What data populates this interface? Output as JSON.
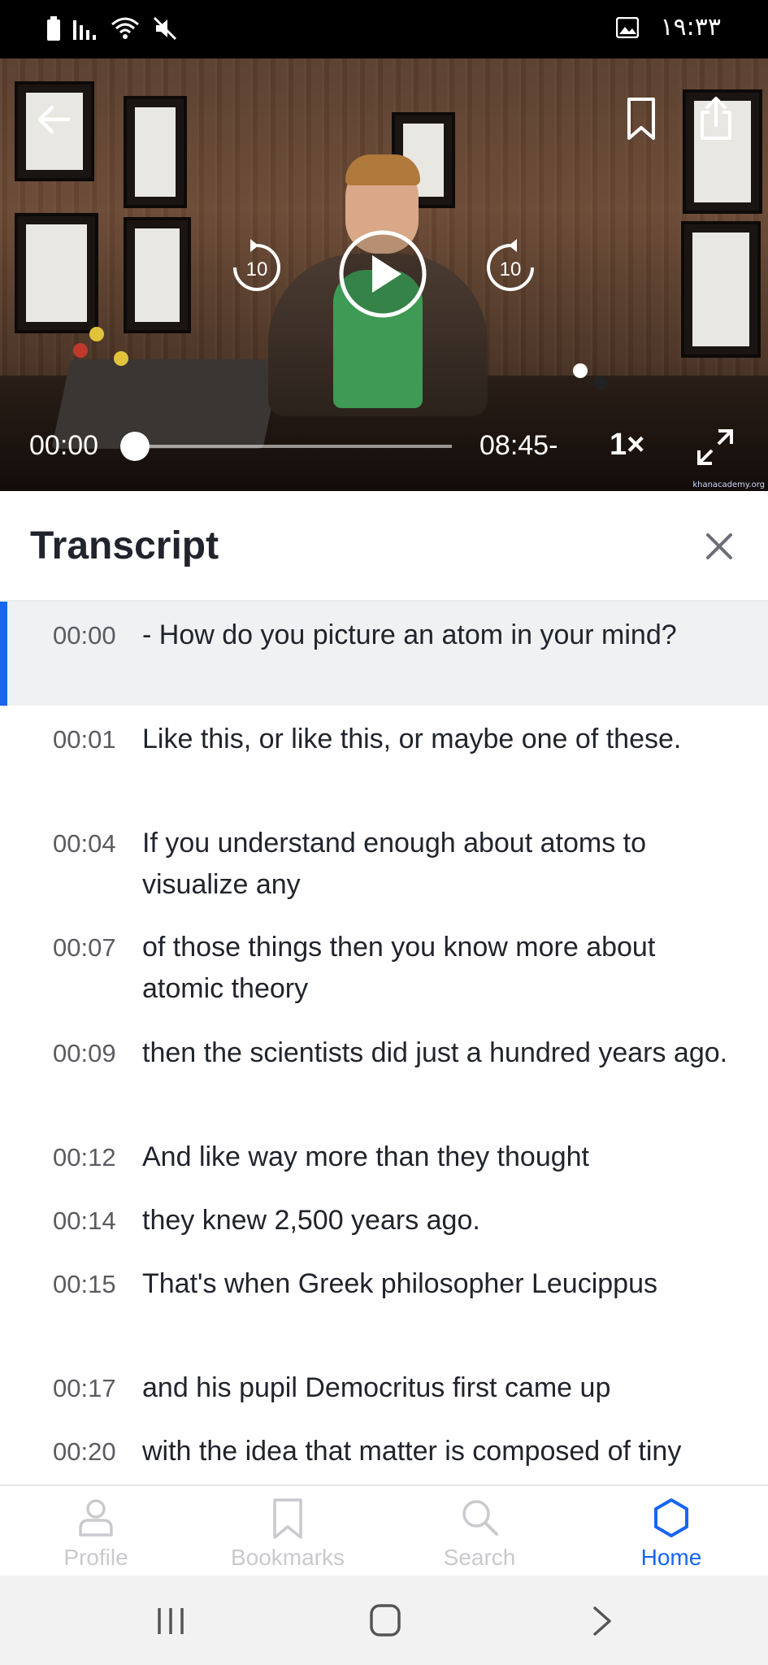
{
  "status_bar": {
    "time": "۱۹:۳۳",
    "icons": [
      "battery-icon",
      "signal-icon",
      "wifi-icon",
      "mute-icon",
      "image-icon"
    ]
  },
  "video": {
    "current_time": "00:00",
    "remaining_time": "08:45-",
    "speed": "1×",
    "rewind_seconds": "10",
    "forward_seconds": "10",
    "progress": 0,
    "watermark": "khanacademy.org"
  },
  "transcript": {
    "title": "Transcript",
    "lines": [
      {
        "time": "00:00",
        "text": "- How do you picture an atom in your mind?",
        "active": true
      },
      {
        "time": "00:01",
        "text": "Like this, or like this, or maybe one of these.",
        "active": false
      },
      {
        "time": "00:04",
        "text": "If you understand enough about atoms to visualize any",
        "active": false
      },
      {
        "time": "00:07",
        "text": "of those things then you know more about atomic theory",
        "active": false
      },
      {
        "time": "00:09",
        "text": "then the scientists did just a hundred years ago.",
        "active": false
      },
      {
        "time": "00:12",
        "text": "And like way more than they thought",
        "active": false
      },
      {
        "time": "00:14",
        "text": "they knew 2,500 years ago.",
        "active": false
      },
      {
        "time": "00:15",
        "text": "That's when Greek philosopher Leucippus",
        "active": false
      },
      {
        "time": "00:17",
        "text": "and his pupil Democritus first came up",
        "active": false
      },
      {
        "time": "00:20",
        "text": "with the idea that matter is composed of tiny",
        "active": false
      }
    ]
  },
  "bottom_nav": {
    "items": [
      {
        "label": "Profile",
        "icon": "profile-icon",
        "selected": false
      },
      {
        "label": "Bookmarks",
        "icon": "bookmark-icon",
        "selected": false
      },
      {
        "label": "Search",
        "icon": "search-icon",
        "selected": false
      },
      {
        "label": "Home",
        "icon": "home-icon",
        "selected": true
      }
    ]
  },
  "colors": {
    "accent": "#1865f2",
    "text": "#21242c",
    "timestamp": "#5b5c61",
    "inactive_nav": "#c9cacd",
    "active_row_bg": "#f0f1f2"
  }
}
